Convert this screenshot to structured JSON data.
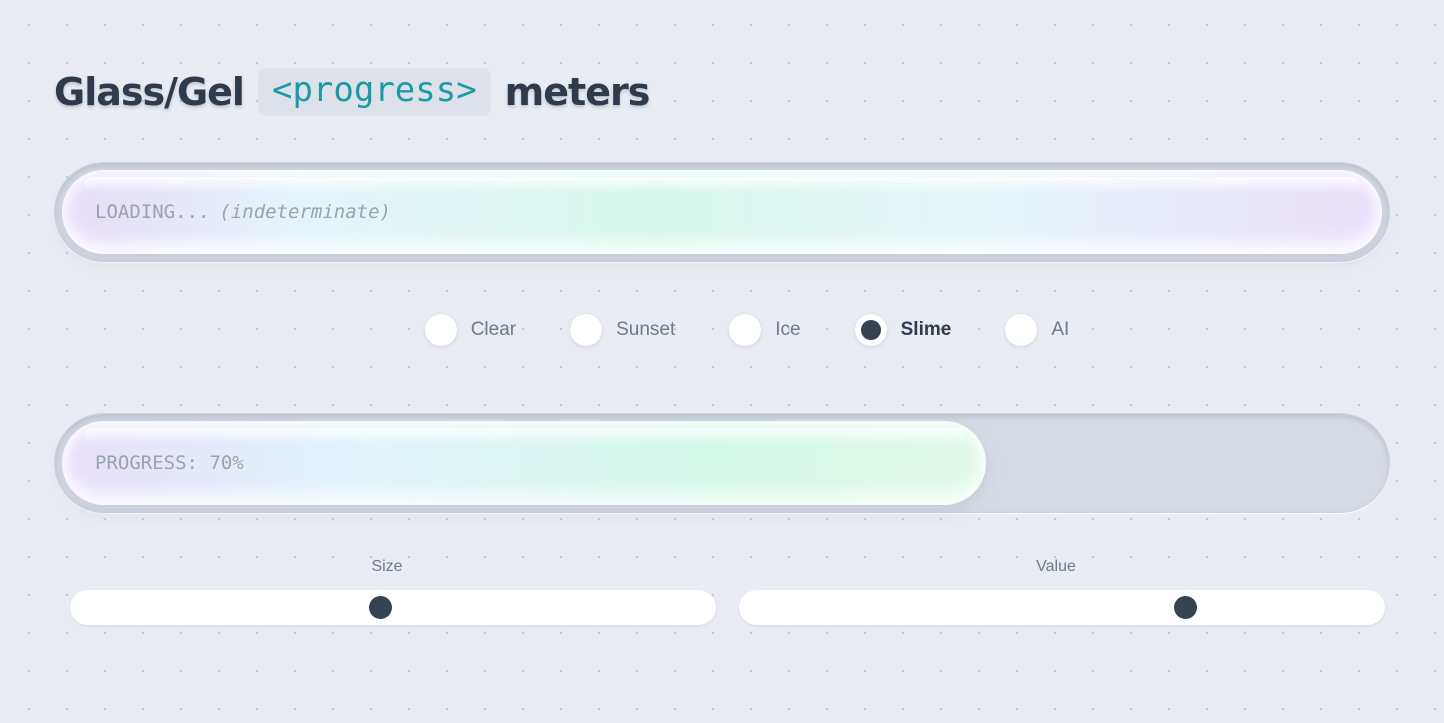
{
  "header": {
    "title_part1": "Glass/Gel",
    "title_code": "<progress>",
    "title_part2": "meters"
  },
  "indeterminate_bar": {
    "label": "LOADING...",
    "note": "(indeterminate)"
  },
  "themes": {
    "selected": "Slime",
    "options": [
      {
        "label": "Clear",
        "checked": false
      },
      {
        "label": "Sunset",
        "checked": false
      },
      {
        "label": "Ice",
        "checked": false
      },
      {
        "label": "Slime",
        "checked": true
      },
      {
        "label": "AI",
        "checked": false
      }
    ]
  },
  "progress_bar": {
    "label": "PROGRESS: 70%",
    "value_fraction": 0.7
  },
  "controls": {
    "size": {
      "label": "Size",
      "value_fraction": 0.48
    },
    "value": {
      "label": "Value",
      "value_fraction": 0.69
    }
  },
  "colors": {
    "title_text": "#2f3a4b",
    "code_accent": "#1b9aa6",
    "radio_checked": "#364152",
    "background": "#e9ecf2"
  }
}
